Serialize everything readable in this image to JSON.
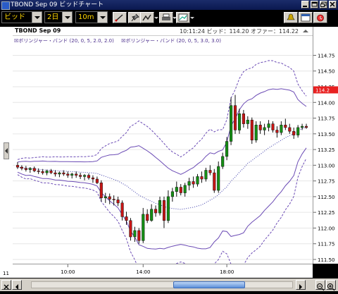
{
  "window": {
    "title": "TBOND Sep 09 ビッドチャート"
  },
  "toolbar": {
    "side": "ビッド",
    "period": "2日",
    "interval": "10m"
  },
  "chart": {
    "symbol": "TBOND Sep 09",
    "info": "10:11:24  ビッド：114.20  オファー：114.22",
    "legend_1": "ボリンジャー・バンド (20, 0, 5, 2.0, 2.0)",
    "legend_2": "ボリンジャー・バンド (20, 0, 5, 3.0, 3.0)",
    "last_price_label": "114.2",
    "corner_label": "11"
  },
  "colors": {
    "up": "#149014",
    "down": "#c81414",
    "band_inner": "#6b4bb5",
    "band_outer": "#6b4bb5",
    "mid": "#3c3caa",
    "last_price": "#e82020"
  },
  "chart_data": {
    "type": "candlestick",
    "y_ticks": [
      "114.75",
      "114.50",
      "114.25",
      "114.00",
      "113.75",
      "113.50",
      "113.25",
      "113.00",
      "112.75",
      "112.50",
      "112.25",
      "112.00",
      "111.75",
      "111.50"
    ],
    "x_ticks": [
      "10:00",
      "14:00",
      "18:00"
    ],
    "ylim": [
      111.5,
      114.8
    ],
    "candles": [
      [
        113.0,
        113.05,
        112.94,
        112.97
      ],
      [
        112.97,
        113.0,
        112.92,
        112.95
      ],
      [
        112.95,
        112.99,
        112.9,
        112.93
      ],
      [
        112.93,
        112.97,
        112.88,
        112.95
      ],
      [
        112.95,
        112.98,
        112.89,
        112.91
      ],
      [
        112.91,
        112.95,
        112.86,
        112.9
      ],
      [
        112.9,
        112.94,
        112.85,
        112.88
      ],
      [
        112.88,
        112.93,
        112.84,
        112.91
      ],
      [
        112.91,
        112.94,
        112.86,
        112.88
      ],
      [
        112.88,
        112.92,
        112.82,
        112.86
      ],
      [
        112.86,
        112.9,
        112.81,
        112.88
      ],
      [
        112.88,
        112.92,
        112.83,
        112.86
      ],
      [
        112.86,
        112.9,
        112.8,
        112.84
      ],
      [
        112.84,
        112.88,
        112.79,
        112.86
      ],
      [
        112.86,
        112.9,
        112.8,
        112.84
      ],
      [
        112.84,
        112.88,
        112.78,
        112.82
      ],
      [
        112.82,
        112.86,
        112.76,
        112.84
      ],
      [
        112.84,
        112.87,
        112.77,
        112.8
      ],
      [
        112.8,
        112.84,
        112.72,
        112.78
      ],
      [
        112.78,
        112.82,
        112.7,
        112.72
      ],
      [
        112.72,
        112.76,
        112.42,
        112.48
      ],
      [
        112.48,
        112.56,
        112.4,
        112.5
      ],
      [
        112.5,
        112.55,
        112.38,
        112.46
      ],
      [
        112.46,
        112.52,
        112.36,
        112.45
      ],
      [
        112.45,
        112.5,
        112.35,
        112.4
      ],
      [
        112.4,
        112.44,
        112.12,
        112.18
      ],
      [
        112.18,
        112.26,
        112.05,
        112.12
      ],
      [
        112.12,
        112.16,
        111.8,
        111.86
      ],
      [
        111.86,
        112.02,
        111.78,
        111.96
      ],
      [
        111.96,
        112.0,
        111.75,
        111.8
      ],
      [
        111.8,
        112.32,
        111.76,
        112.22
      ],
      [
        112.22,
        112.3,
        112.08,
        112.12
      ],
      [
        112.12,
        112.38,
        112.1,
        112.3
      ],
      [
        112.3,
        112.36,
        112.18,
        112.24
      ],
      [
        112.24,
        112.5,
        112.2,
        112.44
      ],
      [
        112.44,
        112.5,
        112.0,
        112.12
      ],
      [
        112.12,
        112.6,
        112.08,
        112.5
      ],
      [
        112.5,
        112.64,
        112.42,
        112.58
      ],
      [
        112.58,
        112.74,
        112.5,
        112.65
      ],
      [
        112.65,
        112.7,
        112.52,
        112.56
      ],
      [
        112.56,
        112.72,
        112.5,
        112.68
      ],
      [
        112.68,
        112.8,
        112.6,
        112.74
      ],
      [
        112.74,
        112.82,
        112.64,
        112.7
      ],
      [
        112.7,
        112.86,
        112.66,
        112.82
      ],
      [
        112.82,
        112.9,
        112.72,
        112.78
      ],
      [
        112.78,
        112.96,
        112.74,
        112.92
      ],
      [
        112.92,
        113.0,
        112.84,
        112.88
      ],
      [
        112.88,
        112.94,
        112.56,
        112.6
      ],
      [
        112.6,
        113.06,
        112.56,
        112.98
      ],
      [
        112.98,
        113.2,
        112.94,
        113.14
      ],
      [
        113.14,
        113.45,
        113.08,
        113.38
      ],
      [
        113.38,
        114.08,
        113.32,
        113.95
      ],
      [
        113.95,
        114.12,
        113.5,
        113.56
      ],
      [
        113.56,
        113.9,
        113.5,
        113.82
      ],
      [
        113.82,
        113.88,
        113.6,
        113.66
      ],
      [
        113.66,
        113.78,
        113.58,
        113.72
      ],
      [
        113.72,
        113.76,
        113.34,
        113.4
      ],
      [
        113.4,
        113.7,
        113.36,
        113.64
      ],
      [
        113.64,
        113.7,
        113.5,
        113.56
      ],
      [
        113.56,
        113.66,
        113.48,
        113.6
      ],
      [
        113.6,
        113.72,
        113.54,
        113.66
      ],
      [
        113.66,
        113.7,
        113.52,
        113.56
      ],
      [
        113.56,
        113.62,
        113.44,
        113.52
      ],
      [
        113.52,
        113.7,
        113.48,
        113.64
      ],
      [
        113.64,
        113.74,
        113.56,
        113.6
      ],
      [
        113.6,
        113.66,
        113.5,
        113.54
      ],
      [
        113.54,
        113.6,
        113.42,
        113.48
      ],
      [
        113.48,
        113.64,
        113.44,
        113.6
      ],
      [
        113.6,
        113.66,
        113.56,
        113.62
      ],
      [
        113.62,
        113.66,
        113.58,
        113.6
      ]
    ]
  }
}
